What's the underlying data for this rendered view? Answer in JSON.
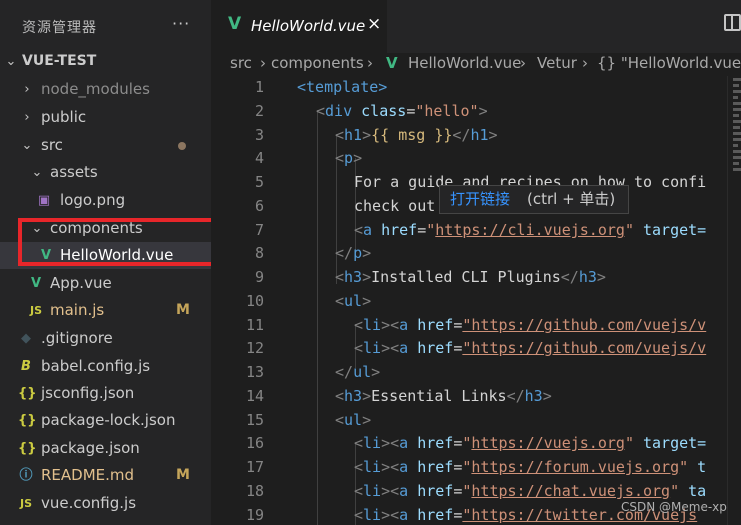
{
  "explorer": {
    "title": "资源管理器",
    "more_label": "···",
    "root": "VUE-TEST",
    "items": [
      {
        "label": "node_modules",
        "kind": "folder",
        "expanded": false
      },
      {
        "label": "public",
        "kind": "folder",
        "expanded": false
      },
      {
        "label": "src",
        "kind": "folder",
        "expanded": true
      },
      {
        "label": "assets",
        "kind": "folder",
        "expanded": true
      },
      {
        "label": "logo.png",
        "kind": "image"
      },
      {
        "label": "components",
        "kind": "folder",
        "expanded": true
      },
      {
        "label": "HelloWorld.vue",
        "kind": "vue",
        "selected": true
      },
      {
        "label": "App.vue",
        "kind": "vue"
      },
      {
        "label": "main.js",
        "kind": "js",
        "badge": "M"
      },
      {
        "label": ".gitignore",
        "kind": "git"
      },
      {
        "label": "babel.config.js",
        "kind": "babel"
      },
      {
        "label": "jsconfig.json",
        "kind": "json"
      },
      {
        "label": "package-lock.json",
        "kind": "json"
      },
      {
        "label": "package.json",
        "kind": "json"
      },
      {
        "label": "README.md",
        "kind": "md",
        "badge": "M"
      },
      {
        "label": "vue.config.js",
        "kind": "js"
      }
    ]
  },
  "tab": {
    "label": "HelloWorld.vue",
    "close": "×"
  },
  "breadcrumb": {
    "parts": [
      "src",
      "components",
      "HelloWorld.vue",
      "Vetur",
      "{} \"HelloWorld.vue\""
    ],
    "sep": "›"
  },
  "editor": {
    "lines": [
      "1",
      "2",
      "3",
      "4",
      "5",
      "6",
      "7",
      "8",
      "9",
      "10",
      "11",
      "12",
      "13",
      "14",
      "15",
      "16",
      "17",
      "18",
      "19"
    ],
    "code": {
      "l1": "<template>",
      "l2_tag": "div",
      "l2_attr": "class",
      "l2_val": "\"hello\"",
      "l3_tag": "h1",
      "l3_mustache": "{{ msg }}",
      "l4_tag": "p",
      "l5_text": "For a guide and recipes on how to confi",
      "l6_text": "check out",
      "l7_tag": "a",
      "l7_attr": "href",
      "l7_url": "https://cli.vuejs.org",
      "l7_rest": " target=",
      "l9_text": "Installed CLI Plugins",
      "l11_url": "\"https://github.com/vuejs/v",
      "l12_url": "\"https://github.com/vuejs/v",
      "l14_text": "Essential Links",
      "l16_url": "https://vuejs.org",
      "l16_rest": " target=",
      "l17_url": "https://forum.vuejs.org",
      "l17_rest": " t",
      "l18_url": "https://chat.vuejs.org",
      "l18_rest": " ta",
      "l19_url": "\"https://twitter.com/vuejs"
    },
    "tooltip": {
      "link": "打开链接",
      "hint": "(ctrl + 单击)"
    }
  },
  "watermark": "CSDN @Meme-xp",
  "colors": {
    "vue": "#41b883",
    "highlight_box": "#e8262a",
    "link": "#3794ff"
  }
}
